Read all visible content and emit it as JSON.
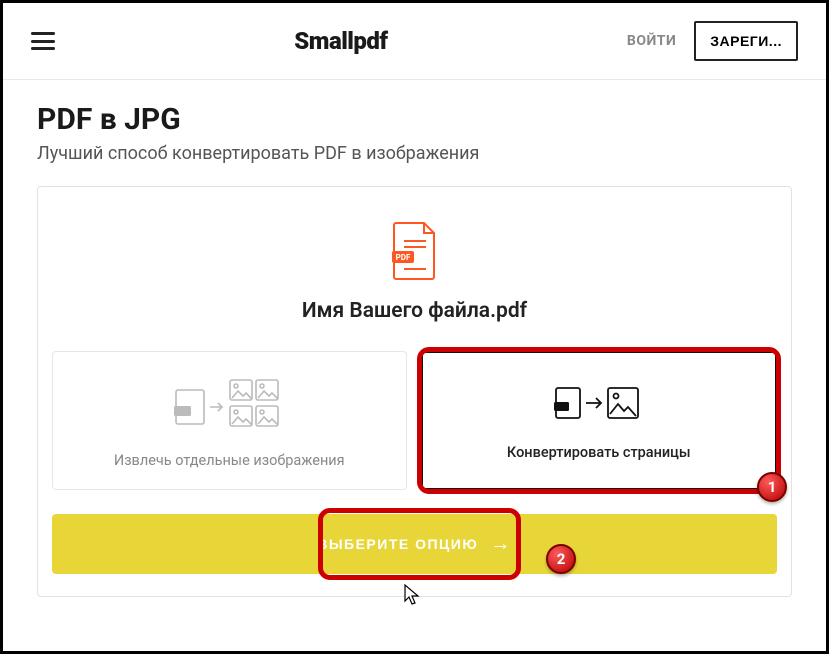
{
  "header": {
    "logo": "Smallpdf",
    "login": "ВОЙТИ",
    "signup": "ЗАРЕГИ..."
  },
  "page": {
    "title": "PDF в JPG",
    "subtitle": "Лучший способ конвертировать PDF в изображения"
  },
  "file": {
    "name": "Имя Вашего файла.pdf"
  },
  "options": {
    "extract": "Извлечь отдельные изображения",
    "convert": "Конвертировать страницы"
  },
  "cta": {
    "label": "ВЫБЕРИТЕ ОПЦИЮ"
  },
  "annotations": {
    "badge1": "1",
    "badge2": "2"
  }
}
